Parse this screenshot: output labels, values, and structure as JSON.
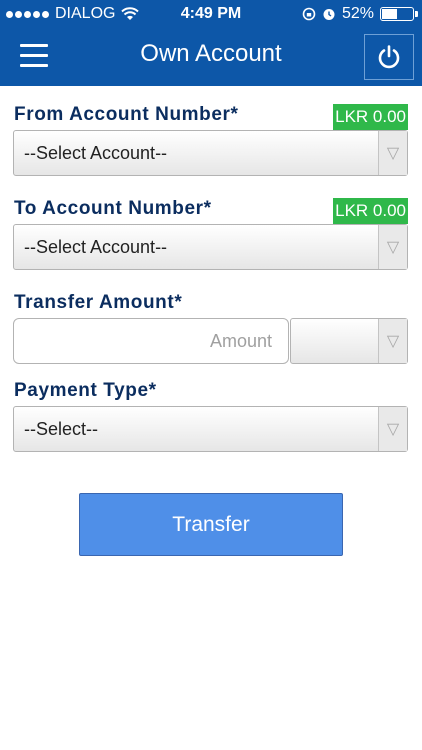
{
  "status_bar": {
    "carrier": "DIALOG",
    "time": "4:49 PM",
    "battery": "52%",
    "battery_level": 0.52,
    "icons": [
      "signal-dots-icon",
      "wifi-icon",
      "rotation-lock-icon",
      "alarm-icon",
      "battery-icon"
    ]
  },
  "header": {
    "title": "Own Account",
    "menu_icon": "hamburger-menu-icon",
    "power_icon": "power-icon"
  },
  "form": {
    "from_account": {
      "label": "From Account Number*",
      "balance": "LKR 0.00",
      "selected": "--Select Account--"
    },
    "to_account": {
      "label": "To Account Number*",
      "balance": "LKR 0.00",
      "selected": "--Select Account--"
    },
    "transfer_amount": {
      "label": "Transfer Amount*",
      "placeholder": "Amount",
      "value": "",
      "currency_selected": ""
    },
    "payment_type": {
      "label": "Payment Type*",
      "selected": "--Select--"
    },
    "submit_label": "Transfer"
  },
  "colors": {
    "header_bg": "#0d57a8",
    "label_text": "#0b2d5f",
    "balance_badge": "#2fb84a",
    "button_bg": "#4f8fe8"
  }
}
